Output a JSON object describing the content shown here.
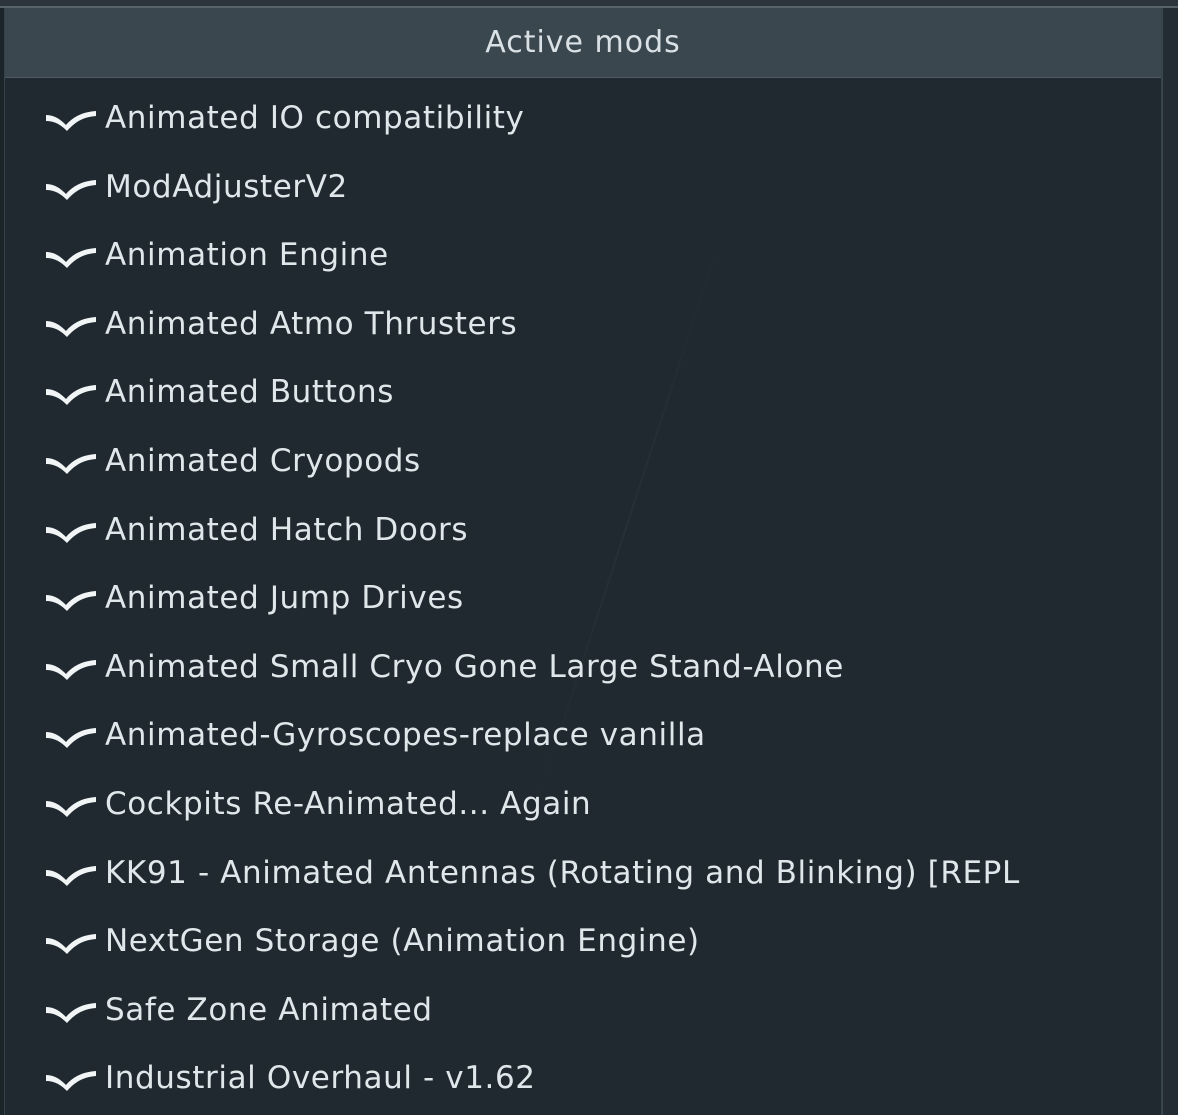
{
  "panel": {
    "title": "Active mods"
  },
  "mods": [
    {
      "label": "Animated IO compatibility",
      "checked": true
    },
    {
      "label": "ModAdjusterV2",
      "checked": true
    },
    {
      "label": "Animation Engine",
      "checked": true
    },
    {
      "label": "Animated Atmo Thrusters",
      "checked": true
    },
    {
      "label": "Animated Buttons",
      "checked": true
    },
    {
      "label": "Animated Cryopods",
      "checked": true
    },
    {
      "label": "Animated Hatch Doors",
      "checked": true
    },
    {
      "label": "Animated Jump Drives",
      "checked": true
    },
    {
      "label": "Animated Small Cryo Gone Large Stand-Alone",
      "checked": true
    },
    {
      "label": "Animated-Gyroscopes-replace vanilla",
      "checked": true
    },
    {
      "label": "Cockpits Re-Animated... Again",
      "checked": true
    },
    {
      "label": "KK91 - Animated Antennas (Rotating and Blinking) [REPL",
      "checked": true
    },
    {
      "label": "NextGen Storage (Animation Engine)",
      "checked": true
    },
    {
      "label": "Safe Zone Animated",
      "checked": true
    },
    {
      "label": "Industrial Overhaul - v1.62",
      "checked": true
    }
  ],
  "icons": {
    "row_icon": "checkmark-icon"
  },
  "colors": {
    "background": "#1f292f",
    "header": "#3b474f",
    "text": "#dfe7ea"
  }
}
